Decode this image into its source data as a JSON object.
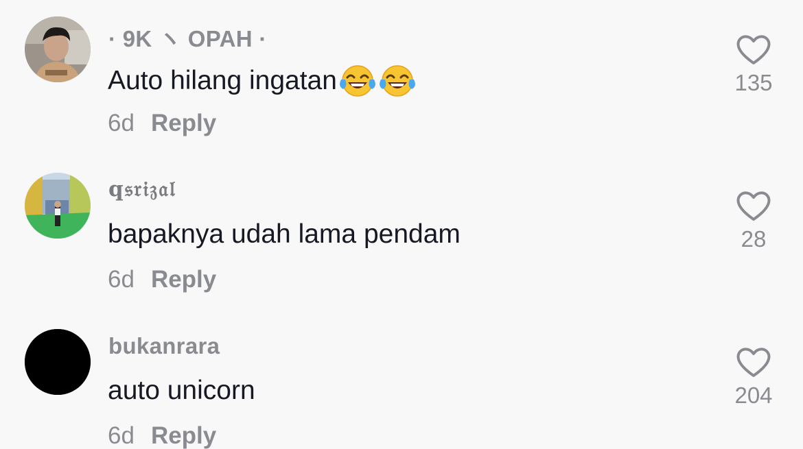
{
  "comments": [
    {
      "username": "· 9K ヽ OPAH ·",
      "text": "Auto hilang ingatan",
      "emojis": [
        "face-with-tears-of-joy",
        "face-with-tears-of-joy"
      ],
      "age": "6d",
      "reply_label": "Reply",
      "likes": "135"
    },
    {
      "username": "q𝔰𝔯𝔦𝔷𝔞𝔩",
      "text": "bapaknya udah lama pendam",
      "age": "6d",
      "reply_label": "Reply",
      "likes": "28"
    },
    {
      "username": "bukanrara",
      "text": "auto unicorn",
      "age": "6d",
      "reply_label": "Reply",
      "likes": "204"
    }
  ],
  "colors": {
    "background": "#f8f8f8",
    "text_primary": "#161823",
    "text_secondary": "#8a8b91"
  }
}
